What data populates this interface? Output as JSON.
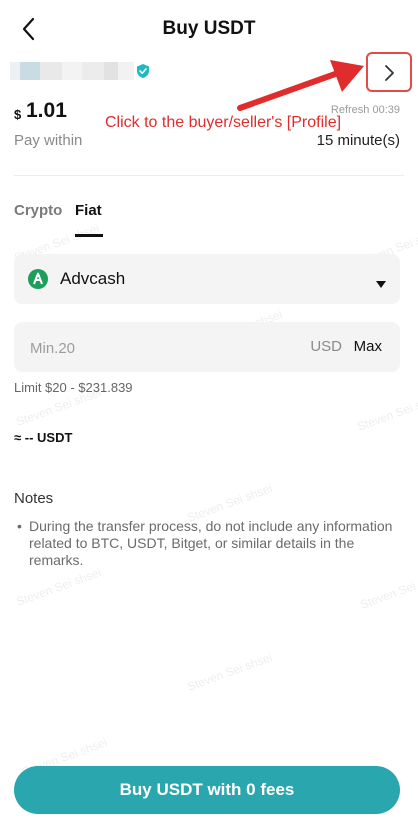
{
  "header": {
    "title": "Buy USDT",
    "back_icon": "chevron-left-icon"
  },
  "merchant": {
    "verified_icon": "shield-check-icon",
    "verified_color": "#21b8c4",
    "profile_icon": "chevron-right-icon"
  },
  "annotation": {
    "text": "Click to the buyer/seller's [Profile]",
    "color": "#e02c2c"
  },
  "price": {
    "currency_symbol": "$",
    "value": "1.01",
    "refresh": "Refresh 00:39"
  },
  "pay_within": {
    "label": "Pay within",
    "value": "15 minute(s)"
  },
  "tabs": [
    {
      "label": "Crypto",
      "active": false
    },
    {
      "label": "Fiat",
      "active": true
    }
  ],
  "payment_method": {
    "label": "Advcash",
    "icon": "advcash-logo-icon",
    "icon_color": "#1e9e5c"
  },
  "amount": {
    "placeholder": "Min.20",
    "currency": "USD",
    "max_label": "Max"
  },
  "limit": "Limit $20 - $231.839",
  "approx": "≈ -- USDT",
  "notes": {
    "title": "Notes",
    "items": [
      "During the transfer process, do not include any information related to BTC, USDT, Bitget, or similar details in the remarks."
    ]
  },
  "watermark": "Steven Sei shsei",
  "cta": {
    "label": "Buy USDT with 0 fees",
    "color": "#2aa6ae"
  }
}
